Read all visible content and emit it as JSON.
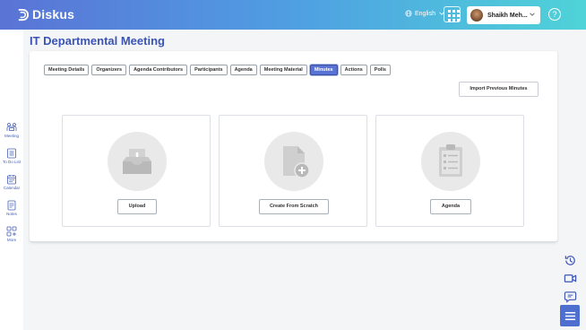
{
  "app": {
    "name": "Diskus"
  },
  "header": {
    "language": "English",
    "user_name": "Shaikh Meh...",
    "help_symbol": "?"
  },
  "sidebar": {
    "items": [
      {
        "label": "Meeting",
        "icon": "meeting-icon"
      },
      {
        "label": "To Do List",
        "icon": "todo-icon"
      },
      {
        "label": "Calendar",
        "icon": "calendar-icon"
      },
      {
        "label": "Notes",
        "icon": "notes-icon"
      },
      {
        "label": "More",
        "icon": "more-icon"
      }
    ]
  },
  "page": {
    "title": "IT Departmental Meeting",
    "tabs": [
      {
        "label": "Meeting Details",
        "active": false
      },
      {
        "label": "Organizers",
        "active": false
      },
      {
        "label": "Agenda Contributors",
        "active": false
      },
      {
        "label": "Participants",
        "active": false
      },
      {
        "label": "Agenda",
        "active": false
      },
      {
        "label": "Meeting Material",
        "active": false
      },
      {
        "label": "Minutes",
        "active": true
      },
      {
        "label": "Actions",
        "active": false
      },
      {
        "label": "Polls",
        "active": false
      }
    ],
    "import_button": "Import Previous Minutes",
    "options": [
      {
        "button": "Upload",
        "icon": "upload-tray-icon"
      },
      {
        "button": "Create From Scratch",
        "icon": "new-document-icon"
      },
      {
        "button": "Agenda",
        "icon": "clipboard-checklist-icon"
      }
    ]
  },
  "right_toolbar": [
    {
      "icon": "history-icon"
    },
    {
      "icon": "video-icon"
    },
    {
      "icon": "chat-icon"
    },
    {
      "icon": "menu-icon"
    }
  ],
  "colors": {
    "accent": "#3b54b5",
    "active_tab": "#5873d3",
    "header_gradient_start": "#5a73d6",
    "header_gradient_end": "#4fd3d8"
  }
}
